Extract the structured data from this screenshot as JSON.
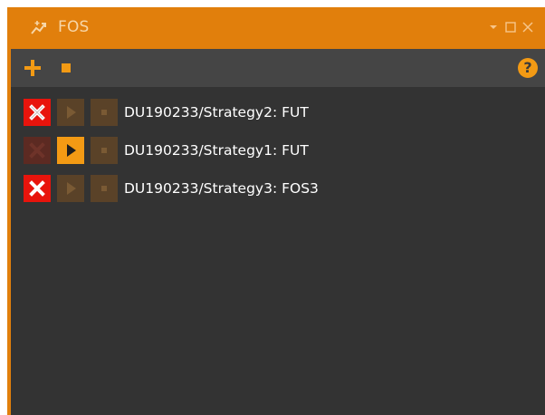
{
  "window": {
    "title": "FOS",
    "title_icon": "strategy-icon",
    "controls": [
      {
        "name": "dropdown-icon"
      },
      {
        "name": "maximize-icon"
      },
      {
        "name": "close-icon"
      }
    ]
  },
  "toolbar": {
    "add_icon": "plus-icon",
    "stop_icon": "stop-icon",
    "help_label": "?"
  },
  "strategies": [
    {
      "label": "DU190233/Strategy2: FUT",
      "remove_enabled": true,
      "play_enabled": false,
      "stop_enabled": false
    },
    {
      "label": "DU190233/Strategy1: FUT",
      "remove_enabled": false,
      "play_enabled": true,
      "stop_enabled": false
    },
    {
      "label": "DU190233/Strategy3: FOS3",
      "remove_enabled": true,
      "play_enabled": false,
      "stop_enabled": false
    }
  ],
  "colors": {
    "accent": "#e17f0c",
    "button_orange": "#f39a14",
    "remove_red": "#e8140c",
    "panel_bg": "#333333",
    "toolbar_bg": "#454545"
  }
}
